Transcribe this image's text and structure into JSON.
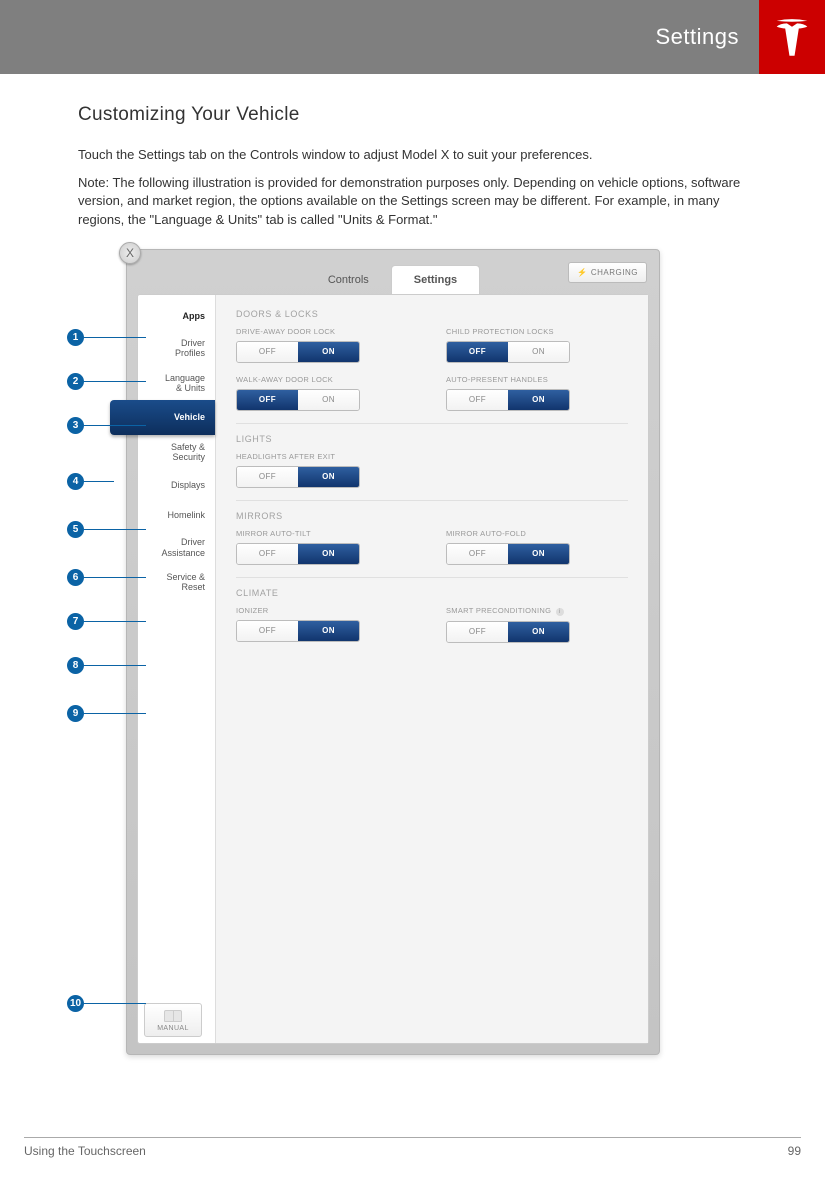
{
  "header": {
    "title": "Settings"
  },
  "section_title": "Customizing Your Vehicle",
  "paragraphs": [
    "Touch the Settings tab on the Controls window to adjust Model X to suit your preferences.",
    "Note: The following illustration is provided for demonstration purposes only. Depending on vehicle options, software version, and market region, the options available on the Settings screen may be different. For example, in many regions, the \"Language & Units\" tab is called \"Units & Format.\""
  ],
  "callouts": [
    "1",
    "2",
    "3",
    "4",
    "5",
    "6",
    "7",
    "8",
    "9",
    "10"
  ],
  "panel": {
    "close": "X",
    "tabs": {
      "controls": "Controls",
      "settings": "Settings"
    },
    "charging": "CHARGING",
    "sidebar": [
      {
        "label": "Apps",
        "bold": true
      },
      {
        "label": "Driver\nProfiles"
      },
      {
        "label": "Language\n& Units"
      },
      {
        "label": "Vehicle",
        "active": true
      },
      {
        "label": "Safety &\nSecurity"
      },
      {
        "label": "Displays"
      },
      {
        "label": "Homelink"
      },
      {
        "label": "Driver\nAssistance"
      },
      {
        "label": "Service &\nReset"
      }
    ],
    "manual": "MANUAL",
    "groups": {
      "doors": {
        "title": "DOORS & LOCKS",
        "items": [
          {
            "label": "DRIVE-AWAY DOOR LOCK",
            "value": "ON"
          },
          {
            "label": "CHILD PROTECTION LOCKS",
            "value": "OFF"
          },
          {
            "label": "WALK-AWAY DOOR LOCK",
            "value": "OFF"
          },
          {
            "label": "AUTO-PRESENT HANDLES",
            "value": "ON"
          }
        ]
      },
      "lights": {
        "title": "LIGHTS",
        "items": [
          {
            "label": "HEADLIGHTS AFTER EXIT",
            "value": "ON"
          }
        ]
      },
      "mirrors": {
        "title": "MIRRORS",
        "items": [
          {
            "label": "MIRROR AUTO-TILT",
            "value": "ON"
          },
          {
            "label": "MIRROR AUTO-FOLD",
            "value": "ON"
          }
        ]
      },
      "climate": {
        "title": "CLIMATE",
        "items": [
          {
            "label": "IONIZER",
            "value": "ON"
          },
          {
            "label": "SMART PRECONDITIONING",
            "value": "ON",
            "info": true
          }
        ]
      }
    },
    "toggle_labels": {
      "off": "OFF",
      "on": "ON"
    }
  },
  "footer": {
    "left": "Using the Touchscreen",
    "right": "99"
  }
}
